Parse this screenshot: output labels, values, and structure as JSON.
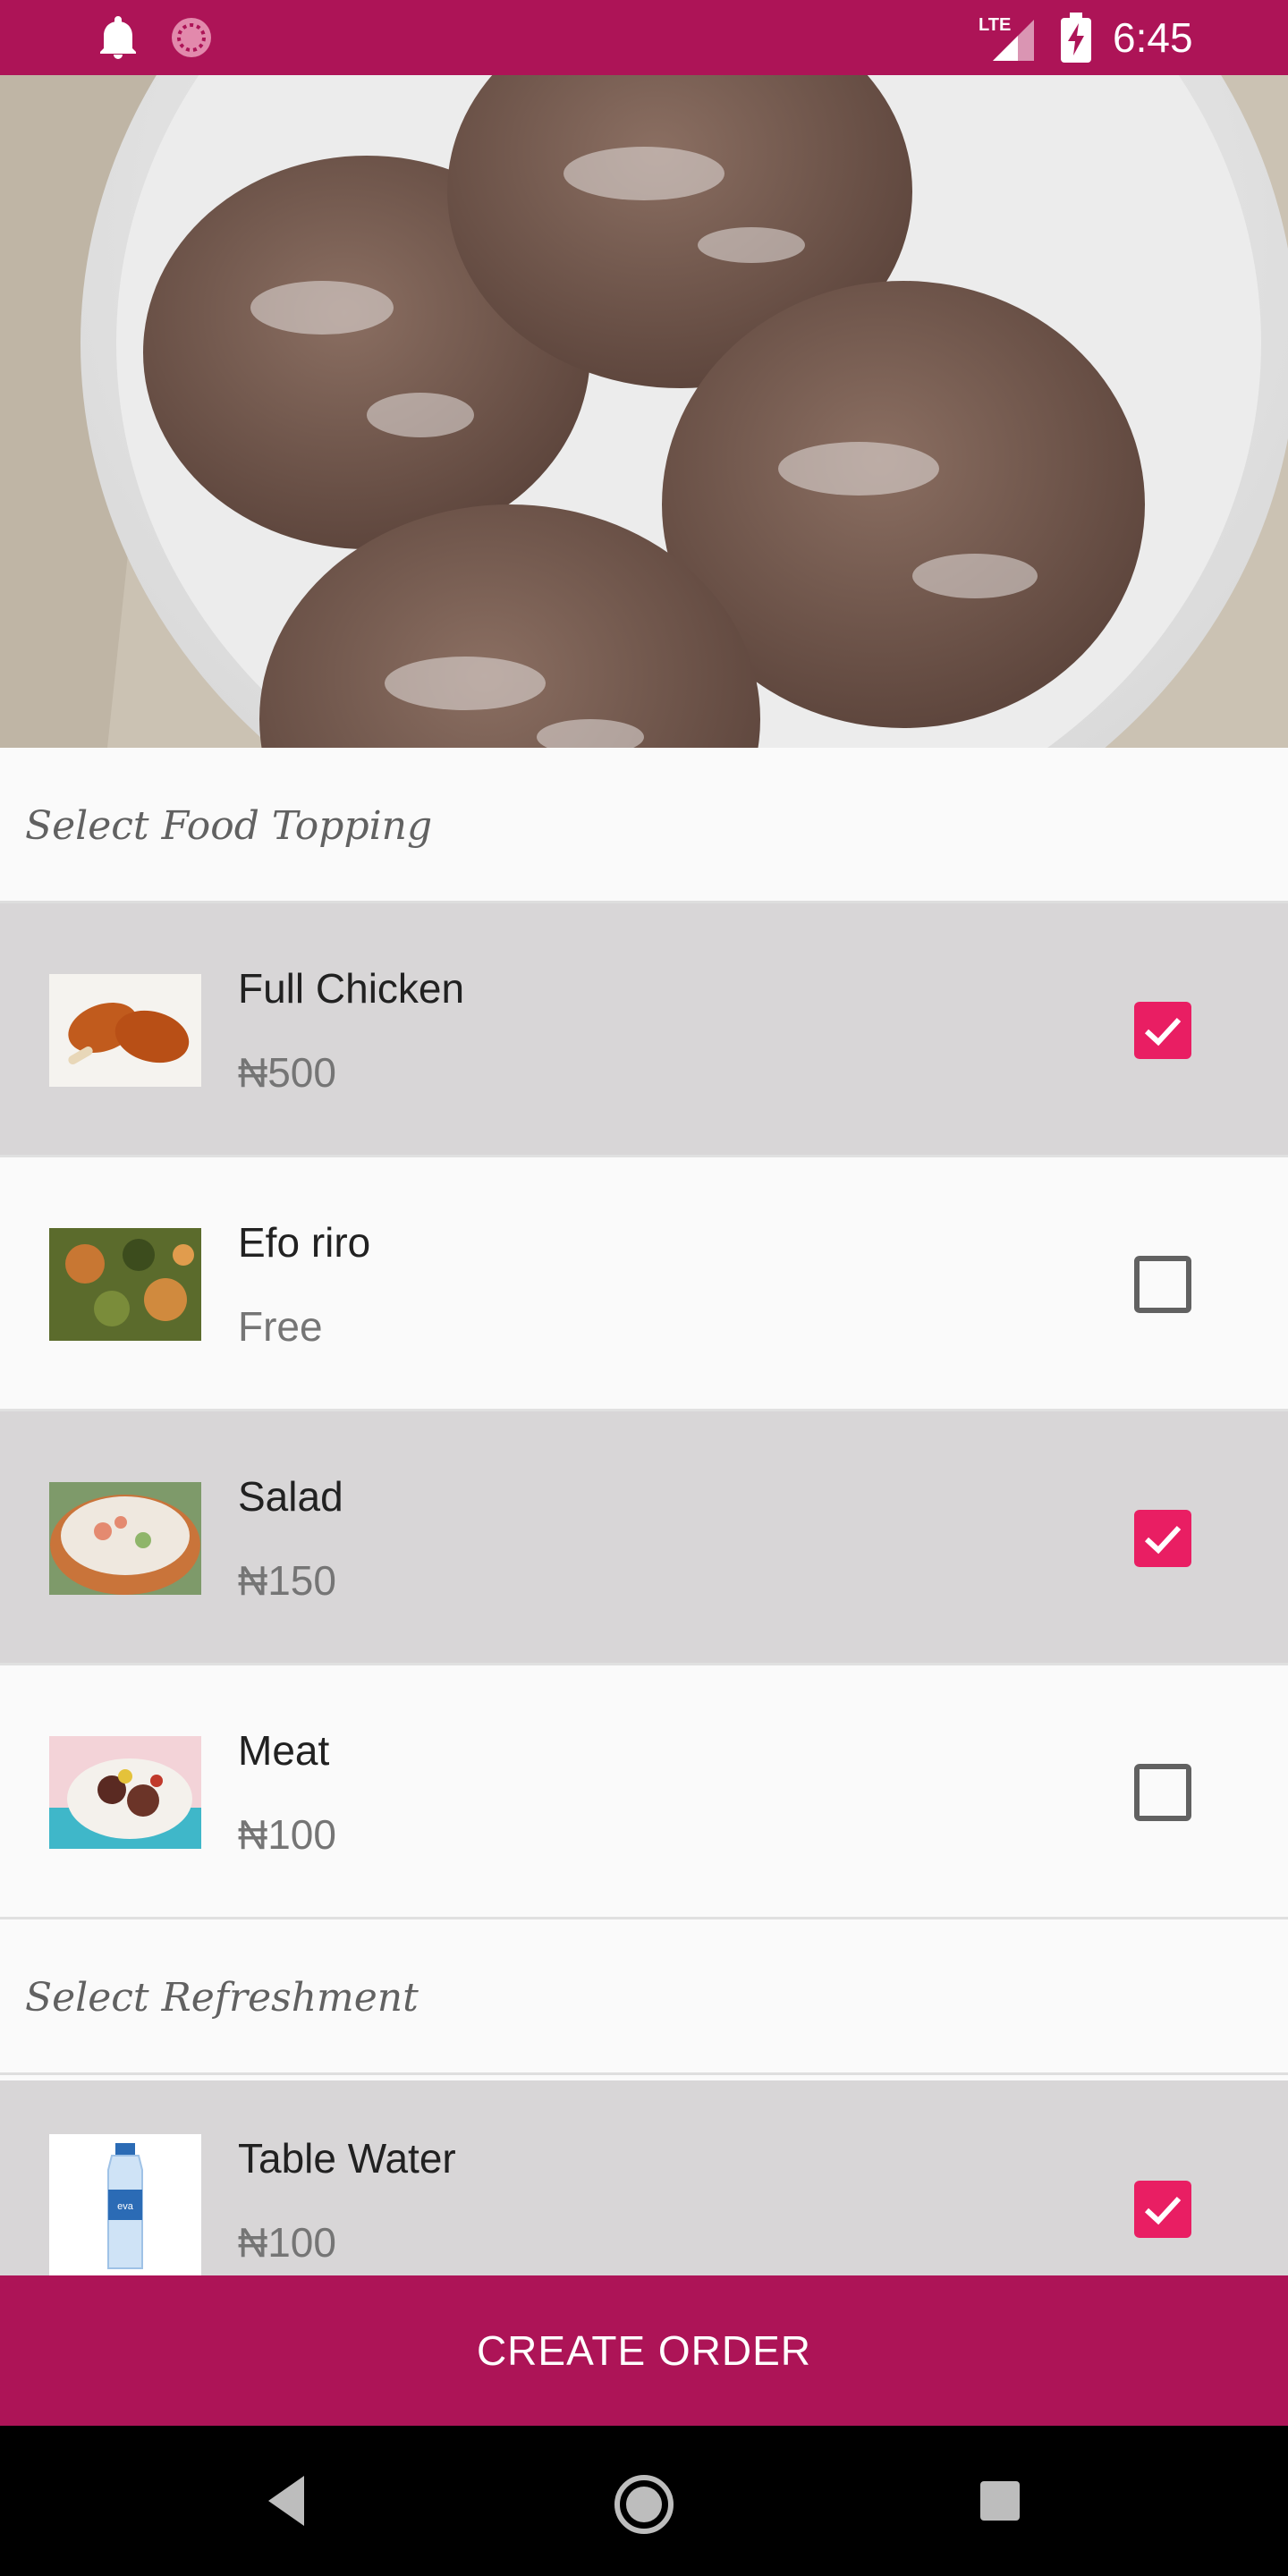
{
  "status_bar": {
    "time": "6:45",
    "network": "LTE",
    "icons": [
      "notification-bell-icon",
      "sync-icon",
      "lte-signal-icon",
      "battery-charging-icon"
    ]
  },
  "hero": {
    "description_icon": "food-photo"
  },
  "sections": {
    "toppings_title": "Select Food Topping",
    "refreshment_title": "Select Refreshment"
  },
  "toppings": [
    {
      "name": "Full Chicken",
      "price": "₦500",
      "checked": true
    },
    {
      "name": "Efo riro",
      "price": "Free",
      "checked": false
    },
    {
      "name": "Salad",
      "price": "₦150",
      "checked": true
    },
    {
      "name": "Meat",
      "price": "₦100",
      "checked": false
    }
  ],
  "refreshments": [
    {
      "name": "Table Water",
      "price": "₦100",
      "checked": true
    }
  ],
  "create_order_label": "CREATE ORDER",
  "colors": {
    "primary": "#ad1457",
    "accent": "#e91e63",
    "row_checked": "#d8d6d7",
    "row_unchecked": "#fafafa"
  }
}
